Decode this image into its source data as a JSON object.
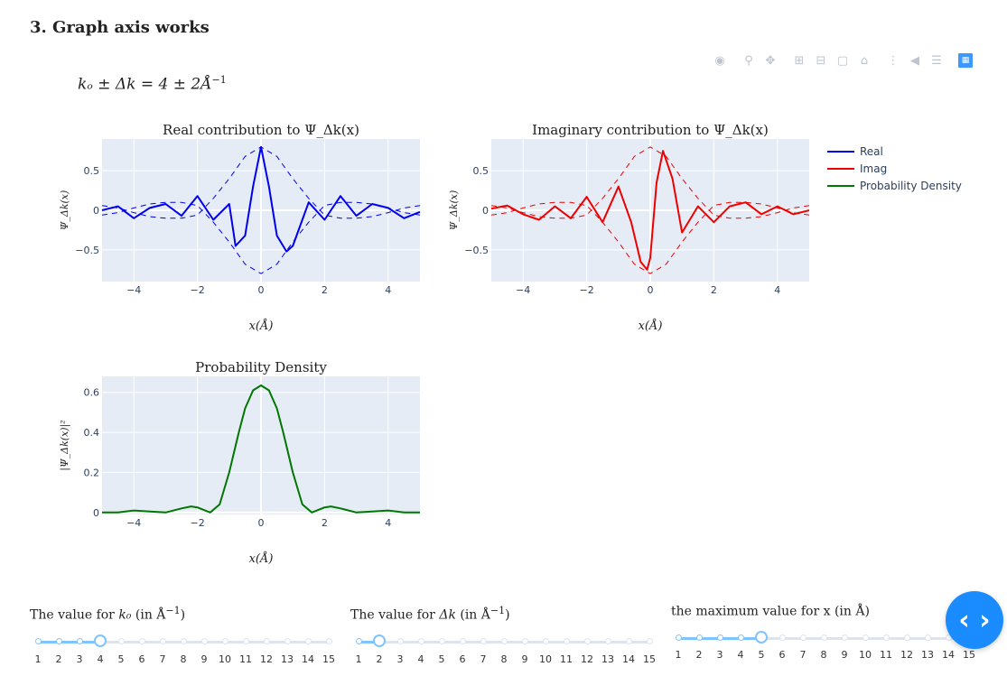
{
  "page": {
    "heading": "3. Graph axis works",
    "formula": "kₒ ± Δk = 4 ± 2Å",
    "formula_exp": "−1"
  },
  "modebar": [
    "camera-icon",
    "zoom-icon",
    "pan-icon",
    "zoom-in-icon",
    "zoom-out-icon",
    "autoscale-icon",
    "home-icon",
    "spike-lines-icon",
    "hover-closest-icon",
    "hover-compare-icon",
    "plotly-logo-icon"
  ],
  "chart_data": [
    {
      "type": "line",
      "title": "Real contribution to Ψ_Δk(x)",
      "xlabel": "x(Å)",
      "ylabel": "Ψ_Δk(x)",
      "xlim": [
        -5,
        5
      ],
      "ylim": [
        -0.9,
        0.9
      ],
      "xticks": [
        -4,
        -2,
        0,
        2,
        4
      ],
      "xtick_labels": [
        "−4",
        "−2",
        "0",
        "2",
        "4"
      ],
      "yticks": [
        -0.5,
        0,
        0.5
      ],
      "ytick_labels": [
        "−0.5",
        "0",
        "0.5"
      ],
      "series": [
        {
          "name": "Real",
          "color": "#0000ee",
          "dash": "solid",
          "x": [
            -5,
            -4.5,
            -4,
            -3.5,
            -3,
            -2.5,
            -2,
            -1.5,
            -1,
            -0.8,
            -0.5,
            -0.25,
            0,
            0.25,
            0.5,
            0.8,
            1,
            1.5,
            2,
            2.5,
            3,
            3.5,
            4,
            4.5,
            5
          ],
          "y": [
            0.0,
            0.05,
            -0.1,
            0.03,
            0.08,
            -0.07,
            0.18,
            -0.12,
            0.08,
            -0.45,
            -0.32,
            0.3,
            0.8,
            0.3,
            -0.32,
            -0.52,
            -0.45,
            0.1,
            -0.12,
            0.18,
            -0.07,
            0.08,
            0.03,
            -0.1,
            -0.02
          ]
        },
        {
          "name": "envelope",
          "color": "#0000ee",
          "dash": "dashed",
          "x": [
            -5,
            -4.5,
            -4,
            -3.5,
            -3,
            -2.5,
            -2,
            -1.5,
            -1,
            -0.5,
            0,
            0.5,
            1,
            1.5,
            2,
            2.5,
            3,
            3.5,
            4,
            4.5,
            5
          ],
          "y": [
            0.06,
            0.03,
            -0.03,
            -0.08,
            -0.1,
            -0.1,
            -0.06,
            0.15,
            0.4,
            0.68,
            0.8,
            0.68,
            0.4,
            0.15,
            -0.06,
            -0.1,
            -0.1,
            -0.08,
            -0.03,
            0.03,
            0.06
          ]
        },
        {
          "name": "envelope",
          "color": "#0000ee",
          "dash": "dashed",
          "x": [
            -5,
            -4.5,
            -4,
            -3.5,
            -3,
            -2.5,
            -2,
            -1.5,
            -1,
            -0.5,
            0,
            0.5,
            1,
            1.5,
            2,
            2.5,
            3,
            3.5,
            4,
            4.5,
            5
          ],
          "y": [
            -0.06,
            -0.03,
            0.03,
            0.08,
            0.1,
            0.1,
            0.06,
            -0.15,
            -0.4,
            -0.68,
            -0.8,
            -0.68,
            -0.4,
            -0.15,
            0.06,
            0.1,
            0.1,
            0.08,
            0.03,
            -0.03,
            -0.06
          ]
        }
      ]
    },
    {
      "type": "line",
      "title": "Imaginary contribution to Ψ_Δk(x)",
      "xlabel": "x(Å)",
      "ylabel": "Ψ_Δk(x)",
      "xlim": [
        -5,
        5
      ],
      "ylim": [
        -0.9,
        0.9
      ],
      "xticks": [
        -4,
        -2,
        0,
        2,
        4
      ],
      "xtick_labels": [
        "−4",
        "−2",
        "0",
        "2",
        "4"
      ],
      "yticks": [
        -0.5,
        0,
        0.5
      ],
      "ytick_labels": [
        "−0.5",
        "0",
        "0.5"
      ],
      "series": [
        {
          "name": "Imag",
          "color": "#ee0000",
          "dash": "solid",
          "x": [
            -5,
            -4.5,
            -4,
            -3.5,
            -3,
            -2.5,
            -2,
            -1.5,
            -1,
            -0.6,
            -0.3,
            -0.1,
            0,
            0.2,
            0.4,
            0.7,
            1,
            1.5,
            2,
            2.5,
            3,
            3.5,
            4,
            4.5,
            5
          ],
          "y": [
            0.02,
            0.06,
            -0.05,
            -0.12,
            0.05,
            -0.1,
            0.17,
            -0.15,
            0.3,
            -0.15,
            -0.65,
            -0.75,
            -0.6,
            0.35,
            0.75,
            0.4,
            -0.28,
            0.05,
            -0.15,
            0.05,
            0.1,
            -0.05,
            0.05,
            -0.05,
            0.0
          ]
        },
        {
          "name": "envelope",
          "color": "#ee0000",
          "dash": "dashed",
          "x": [
            -5,
            -4.5,
            -4,
            -3.5,
            -3,
            -2.5,
            -2,
            -1.5,
            -1,
            -0.5,
            0,
            0.5,
            1,
            1.5,
            2,
            2.5,
            3,
            3.5,
            4,
            4.5,
            5
          ],
          "y": [
            0.06,
            0.03,
            -0.03,
            -0.08,
            -0.1,
            -0.1,
            -0.06,
            0.15,
            0.4,
            0.68,
            0.8,
            0.68,
            0.4,
            0.15,
            -0.06,
            -0.1,
            -0.1,
            -0.08,
            -0.03,
            0.03,
            0.06
          ]
        },
        {
          "name": "envelope",
          "color": "#ee0000",
          "dash": "dashed",
          "x": [
            -5,
            -4.5,
            -4,
            -3.5,
            -3,
            -2.5,
            -2,
            -1.5,
            -1,
            -0.5,
            0,
            0.5,
            1,
            1.5,
            2,
            2.5,
            3,
            3.5,
            4,
            4.5,
            5
          ],
          "y": [
            -0.06,
            -0.03,
            0.03,
            0.08,
            0.1,
            0.1,
            0.06,
            -0.15,
            -0.4,
            -0.68,
            -0.8,
            -0.68,
            -0.4,
            -0.15,
            0.06,
            0.1,
            0.1,
            0.08,
            0.03,
            -0.03,
            -0.06
          ]
        }
      ]
    },
    {
      "type": "line",
      "title": "Probability Density",
      "xlabel": "x(Å)",
      "ylabel": "|Ψ_Δk(x)|²",
      "xlim": [
        -5,
        5
      ],
      "ylim": [
        -0.01,
        0.68
      ],
      "xticks": [
        -4,
        -2,
        0,
        2,
        4
      ],
      "xtick_labels": [
        "−4",
        "−2",
        "0",
        "2",
        "4"
      ],
      "yticks": [
        0,
        0.2,
        0.4,
        0.6
      ],
      "ytick_labels": [
        "0",
        "0.2",
        "0.4",
        "0.6"
      ],
      "series": [
        {
          "name": "Probability Density",
          "color": "#007700",
          "dash": "solid",
          "x": [
            -5,
            -4.5,
            -4,
            -3.5,
            -3,
            -2.5,
            -2.2,
            -2,
            -1.6,
            -1.3,
            -1,
            -0.7,
            -0.5,
            -0.25,
            0,
            0.25,
            0.5,
            0.7,
            1,
            1.3,
            1.6,
            2,
            2.2,
            2.5,
            3,
            3.5,
            4,
            4.5,
            5
          ],
          "y": [
            0.0,
            0.0,
            0.01,
            0.005,
            0.0,
            0.02,
            0.03,
            0.025,
            0.0,
            0.04,
            0.2,
            0.4,
            0.52,
            0.61,
            0.635,
            0.61,
            0.52,
            0.4,
            0.2,
            0.04,
            0.0,
            0.025,
            0.03,
            0.02,
            0.0,
            0.005,
            0.01,
            0.0,
            0.0
          ]
        }
      ]
    }
  ],
  "legend": [
    {
      "name": "Real",
      "color": "#0000ee"
    },
    {
      "name": "Imag",
      "color": "#ee0000"
    },
    {
      "name": "Probability Density",
      "color": "#007700"
    }
  ],
  "sliders": [
    {
      "label_pre": "The value for ",
      "label_sym": "k₀",
      "label_post": " (in Å",
      "label_exp": "−1",
      "label_close": ")",
      "ticks": [
        "1",
        "2",
        "3",
        "4",
        "5",
        "6",
        "7",
        "8",
        "9",
        "10",
        "11",
        "12",
        "13",
        "14",
        "15"
      ],
      "value_index": 3
    },
    {
      "label_pre": "The value for ",
      "label_sym": "Δk",
      "label_post": " (in Å",
      "label_exp": "−1",
      "label_close": ")",
      "ticks": [
        "1",
        "2",
        "3",
        "4",
        "5",
        "6",
        "7",
        "8",
        "9",
        "10",
        "11",
        "12",
        "13",
        "14",
        "15"
      ],
      "value_index": 1
    },
    {
      "label_pre": "the maximum value for x (in Å)",
      "label_sym": "",
      "label_post": "",
      "label_exp": "",
      "label_close": "",
      "ticks": [
        "1",
        "2",
        "3",
        "4",
        "5",
        "6",
        "7",
        "8",
        "9",
        "10",
        "11",
        "12",
        "13",
        "14",
        "15"
      ],
      "value_index": 4
    }
  ],
  "fab": {
    "label": "‹ ›"
  }
}
